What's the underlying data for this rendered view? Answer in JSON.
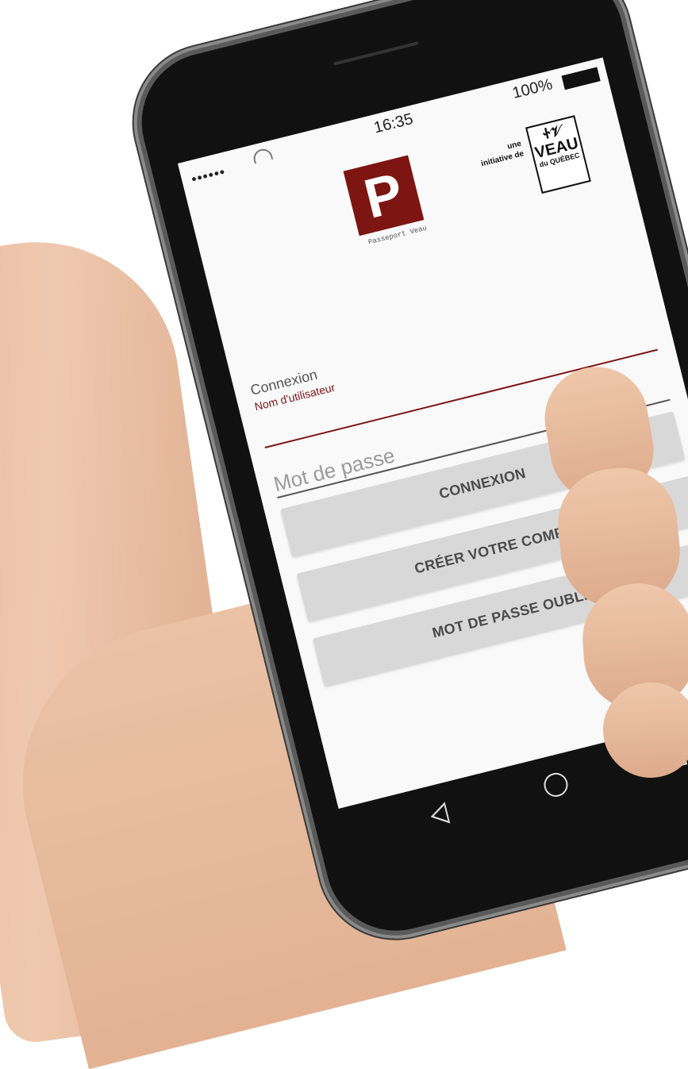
{
  "status_bar": {
    "signal": "••••••",
    "time": "16:35",
    "battery_percent": "100%"
  },
  "branding": {
    "logo_letter": "P",
    "logo_caption": "Passeport Veau",
    "initiative_text": "une initiative de",
    "partner_logo_word": "VEAU",
    "partner_logo_sub": "du QUÉBEC",
    "brand_color": "#7d1512"
  },
  "login_form": {
    "section_title": "Connexion",
    "username_label": "Nom d'utilisateur",
    "password_placeholder": "Mot de passe"
  },
  "buttons": {
    "login": "CONNEXION",
    "create_account": "CRÉER VOTRE COMPTE",
    "forgot_password": "MOT DE PASSE OUBLIÉ"
  },
  "nav_bar": {
    "back_icon": "triangle-back-icon",
    "home_icon": "circle-home-icon",
    "recent_icon": "square-recent-icon"
  }
}
